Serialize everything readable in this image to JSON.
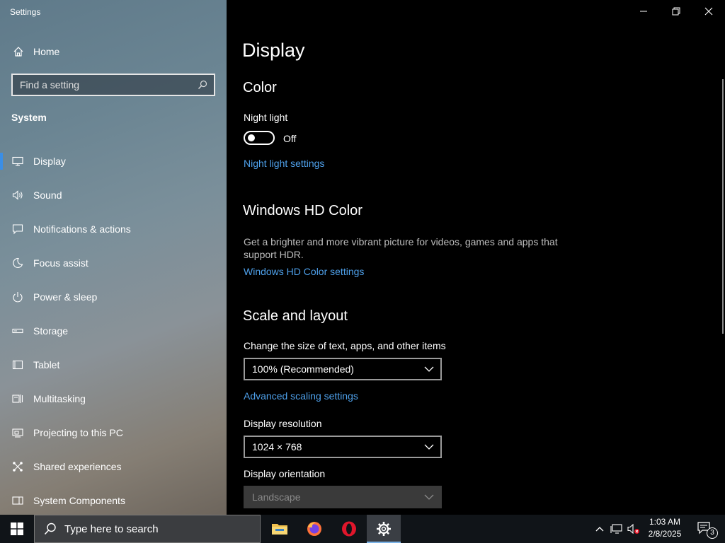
{
  "app": {
    "title": "Settings"
  },
  "sidebar": {
    "home_label": "Home",
    "search_placeholder": "Find a setting",
    "section": "System",
    "items": [
      {
        "label": "Display",
        "icon": "monitor-icon"
      },
      {
        "label": "Sound",
        "icon": "speaker-icon"
      },
      {
        "label": "Notifications & actions",
        "icon": "notification-icon"
      },
      {
        "label": "Focus assist",
        "icon": "moon-icon"
      },
      {
        "label": "Power & sleep",
        "icon": "power-icon"
      },
      {
        "label": "Storage",
        "icon": "storage-icon"
      },
      {
        "label": "Tablet",
        "icon": "tablet-icon"
      },
      {
        "label": "Multitasking",
        "icon": "multitasking-icon"
      },
      {
        "label": "Projecting to this PC",
        "icon": "projecting-icon"
      },
      {
        "label": "Shared experiences",
        "icon": "shared-experiences-icon"
      },
      {
        "label": "System Components",
        "icon": "system-components-icon"
      }
    ]
  },
  "main": {
    "page_title": "Display",
    "color": {
      "heading": "Color",
      "night_light_label": "Night light",
      "night_light_state": "Off",
      "night_light_link": "Night light settings"
    },
    "hd_color": {
      "heading": "Windows HD Color",
      "description": "Get a brighter and more vibrant picture for videos, games and apps that support HDR.",
      "link": "Windows HD Color settings"
    },
    "scale_layout": {
      "heading": "Scale and layout",
      "size_label": "Change the size of text, apps, and other items",
      "size_value": "100% (Recommended)",
      "advanced_link": "Advanced scaling settings",
      "resolution_label": "Display resolution",
      "resolution_value": "1024 × 768",
      "orientation_label": "Display orientation",
      "orientation_value": "Landscape"
    }
  },
  "taskbar": {
    "search_placeholder": "Type here to search",
    "apps": [
      "file-explorer-icon",
      "firefox-icon",
      "opera-icon",
      "settings-icon"
    ],
    "time": "1:03 AM",
    "date": "2/8/2025",
    "notification_count": "3"
  },
  "colors": {
    "accent": "#3a8ee6",
    "link": "#4ea0ea"
  }
}
